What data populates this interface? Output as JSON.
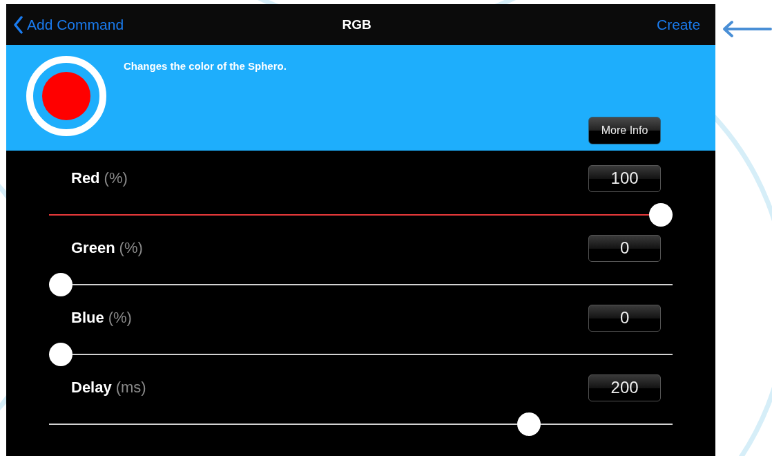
{
  "nav_bar": {
    "back_label": "Add Command",
    "title": "RGB",
    "action": "Create"
  },
  "header": {
    "description": "Changes the color of the Sphero.",
    "button": "More Info"
  },
  "sliders": [
    {
      "name": "Red",
      "unit": "(%)",
      "value": "100",
      "level": 1.0,
      "color": "#e8393a"
    },
    {
      "name": "Green",
      "unit": "(%)",
      "value": "0",
      "level": 0.0
    },
    {
      "name": "Blue",
      "unit": "(%)",
      "value": "0",
      "level": 0.0
    },
    {
      "name": "Delay",
      "unit": "(ms)",
      "value": "200",
      "level": 0.78,
      "color": "#d2d2d2"
    }
  ]
}
